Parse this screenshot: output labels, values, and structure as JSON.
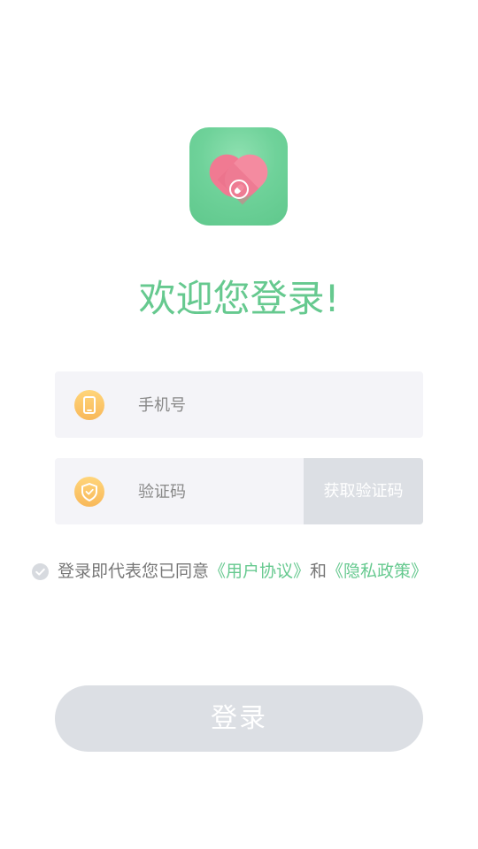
{
  "icons": {
    "app_logo": "heart-pill-logo-icon",
    "phone": "phone-icon",
    "code": "shield-check-icon",
    "agree": "check-circle-icon"
  },
  "colors": {
    "brand_green": "#66c98f",
    "logo_green": "#6fd29a",
    "heart_pink": "#f07a92",
    "icon_orange": "#f8b85a",
    "field_bg": "#f4f4f8",
    "disabled_gray": "#dcdfe4"
  },
  "welcome": {
    "title": "欢迎您登录!"
  },
  "phone_field": {
    "placeholder": "手机号",
    "value": ""
  },
  "code_field": {
    "placeholder": "验证码",
    "value": "",
    "get_code_label": "获取验证码"
  },
  "agreement": {
    "prefix": "登录即代表您已同意",
    "user_agreement": "《用户协议》",
    "conjunction": "和",
    "privacy_policy": "《隐私政策》",
    "checked": false
  },
  "login": {
    "label": "登录"
  }
}
